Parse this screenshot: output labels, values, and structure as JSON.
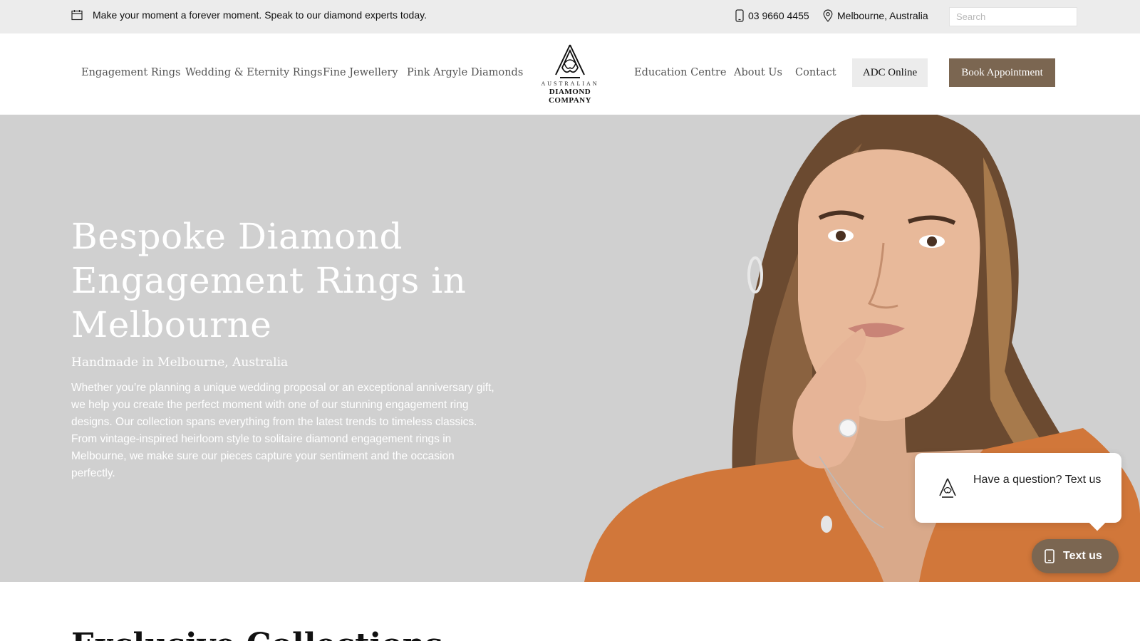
{
  "topbar": {
    "promo_icon": "calendar-icon",
    "promo_text": "Make your moment a forever moment. Speak to our diamond experts today.",
    "phone_icon": "phone-icon",
    "phone": "03 9660 4455",
    "location_icon": "location-pin-icon",
    "location": "Melbourne, Australia",
    "search_placeholder": "Search"
  },
  "nav": {
    "left": [
      "Engagement Rings",
      "Wedding & Eternity Rings",
      "Fine Jewellery",
      "Pink Argyle Diamonds"
    ],
    "right": [
      "Education Centre",
      "About Us",
      "Contact"
    ],
    "online_button": "ADC Online",
    "book_button": "Book Appointment"
  },
  "logo": {
    "line1": "AUSTRALIAN",
    "line2": "DIAMOND COMPANY"
  },
  "hero": {
    "title": "Bespoke Diamond Engagement Rings in Melbourne",
    "subtitle": "Handmade in Melbourne, Australia",
    "body": "Whether you’re planning a unique wedding proposal or an exceptional anniversary gift, we help you create the perfect moment with one of our stunning engagement ring designs. Our collection spans everything from the latest trends to timeless classics. From vintage-inspired heirloom style to solitaire diamond engagement rings in Melbourne, we make sure our pieces capture your sentiment and the occasion perfectly."
  },
  "chat": {
    "bubble_text": "Have a question? Text us",
    "button_label": "Text us"
  },
  "section": {
    "heading": "Exclusive Collections"
  },
  "colors": {
    "accent": "#7b6651",
    "hero_bg": "#d0d0d0",
    "topbar_bg": "#ececec"
  }
}
